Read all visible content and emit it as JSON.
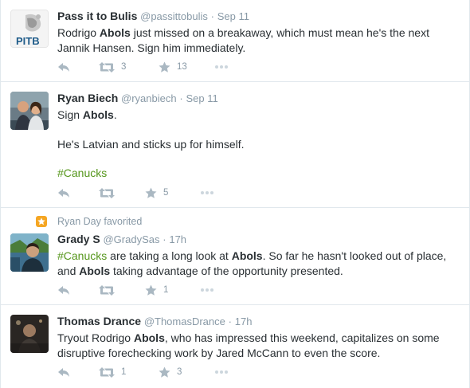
{
  "tweets": [
    {
      "fullname": "Pass it to Bulis",
      "username": "@passittobulis",
      "time": "Sep 11",
      "avatar_text": "PITB",
      "text_parts": [
        "Rodrigo ",
        "Abols",
        " just missed on a breakaway, which must mean he's the next Jannik Hansen. Sign him immediately."
      ],
      "retweets": "3",
      "favorites": "13"
    },
    {
      "fullname": "Ryan Biech",
      "username": "@ryanbiech",
      "time": "Sep 11",
      "line1_parts": [
        "Sign ",
        "Abols",
        "."
      ],
      "line2": "He's Latvian and sticks up for himself.",
      "hashtag": "#Canucks",
      "retweets": "",
      "favorites": "5"
    },
    {
      "context": "Ryan Day favorited",
      "fullname": "Grady S",
      "username": "@GradySas",
      "time": "17h",
      "hashtag": "#Canucks",
      "text_parts": [
        " are taking a long look at ",
        "Abols",
        ". So far he hasn't looked out of place, and ",
        "Abols",
        " taking advantage of the opportunity presented."
      ],
      "retweets": "",
      "favorites": "1"
    },
    {
      "fullname": "Thomas Drance",
      "username": "@ThomasDrance",
      "time": "17h",
      "text_parts": [
        "Tryout Rodrigo ",
        "Abols",
        ", who has impressed this weekend, capitalizes on some disruptive forechecking work by Jared McCann to even the score."
      ],
      "retweets": "1",
      "favorites": "3"
    }
  ],
  "separator": "·",
  "colors": {
    "link": "#55961b",
    "meta": "#8899a6",
    "action": "#aab8c2",
    "favorited": "#f5a623"
  },
  "icons": [
    "reply-icon",
    "retweet-icon",
    "favorite-icon",
    "more-icon"
  ]
}
